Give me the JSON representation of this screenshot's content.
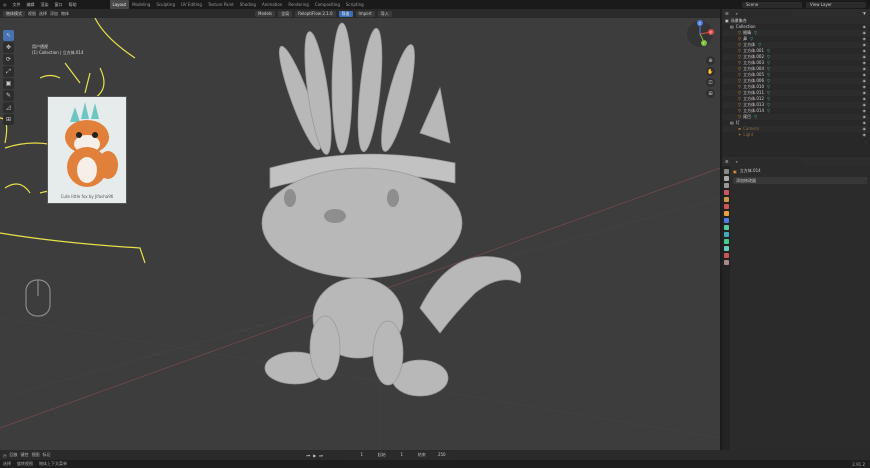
{
  "menubar": {
    "menus": [
      "文件",
      "编辑",
      "渲染",
      "窗口",
      "帮助"
    ],
    "workspaces": [
      "Layout",
      "Modeling",
      "Sculpting",
      "UV Editing",
      "Texture Paint",
      "Shading",
      "Animation",
      "Rendering",
      "Compositing",
      "Scripting"
    ],
    "active_workspace": "Layout",
    "scene": "Scene",
    "view_layer": "View Layer"
  },
  "viewport_header": {
    "mode": "物体模式",
    "menus": [
      "视图",
      "选择",
      "添加",
      "物体"
    ],
    "transform": "全局",
    "addon_label": "Models",
    "right_buttons": [
      "导出",
      "Import",
      "导入"
    ],
    "addon_version": "ReloptiFlow 2.1.0"
  },
  "viewport": {
    "view_name": "用户透视",
    "collection_path": "(1) Collection | 立方体.014",
    "reference_caption": "Cute little fox by Jifasha96",
    "gizmo": {
      "x": "X",
      "y": "Y",
      "z": "Z"
    }
  },
  "toolbar": {
    "tools": [
      "↖",
      "✥",
      "⟳",
      "⤢",
      "▣",
      "✎",
      "◿",
      "⊞"
    ]
  },
  "outliner": {
    "title": "场景集合",
    "search_placeholder": "",
    "rows": [
      {
        "label": "Collection",
        "indent": 0,
        "kind": "collection"
      },
      {
        "label": "眼睛",
        "indent": 1,
        "kind": "mesh"
      },
      {
        "label": "鼻",
        "indent": 1,
        "kind": "mesh"
      },
      {
        "label": "立方体",
        "indent": 1,
        "kind": "mesh"
      },
      {
        "label": "立方体.001",
        "indent": 1,
        "kind": "mesh"
      },
      {
        "label": "立方体.002",
        "indent": 1,
        "kind": "mesh"
      },
      {
        "label": "立方体.003",
        "indent": 1,
        "kind": "mesh"
      },
      {
        "label": "立方体.004",
        "indent": 1,
        "kind": "mesh"
      },
      {
        "label": "立方体.005",
        "indent": 1,
        "kind": "mesh"
      },
      {
        "label": "立方体.006",
        "indent": 1,
        "kind": "mesh"
      },
      {
        "label": "立方体.010",
        "indent": 1,
        "kind": "mesh"
      },
      {
        "label": "立方体.011",
        "indent": 1,
        "kind": "mesh"
      },
      {
        "label": "立方体.012",
        "indent": 1,
        "kind": "mesh"
      },
      {
        "label": "立方体.013",
        "indent": 1,
        "kind": "mesh"
      },
      {
        "label": "立方体.014",
        "indent": 1,
        "kind": "mesh"
      },
      {
        "label": "尾巴",
        "indent": 1,
        "kind": "mesh"
      },
      {
        "label": "灯",
        "indent": 0,
        "kind": "collection"
      },
      {
        "label": "Camera",
        "indent": 1,
        "kind": "camera"
      },
      {
        "label": "Light",
        "indent": 1,
        "kind": "light"
      }
    ]
  },
  "properties": {
    "object_name": "立方体.014",
    "section": "添加修改器"
  },
  "timeline": {
    "menus": [
      "回放",
      "键控",
      "视图",
      "标记"
    ],
    "frame_current": "1",
    "start_label": "起始",
    "start": "1",
    "end_label": "结束",
    "end": "250"
  },
  "status": {
    "items": [
      "选择",
      "旋转视图",
      "物体上下文菜单"
    ],
    "version": "2.91.2"
  }
}
